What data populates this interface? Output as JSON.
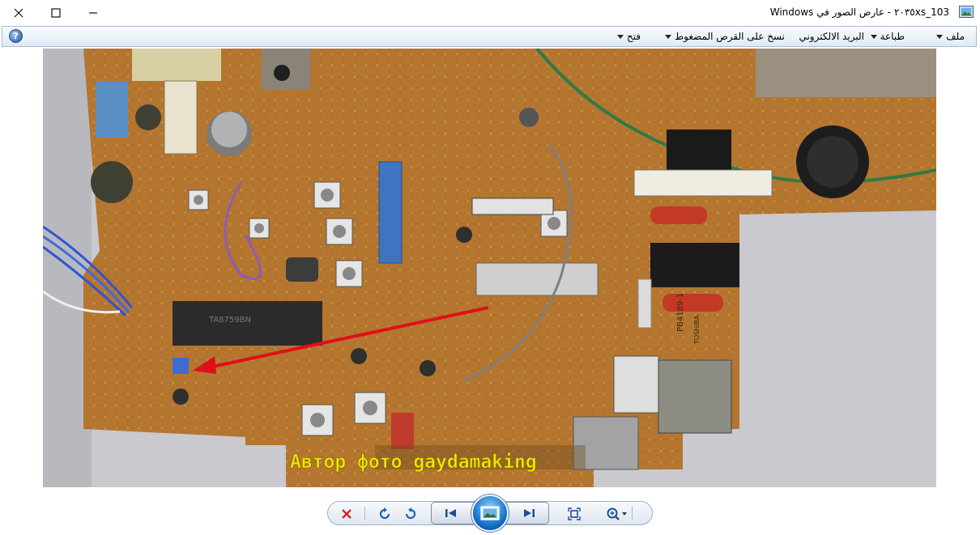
{
  "window": {
    "title": "٢٠٣٥xs_103 - عارض الصور في Windows"
  },
  "menu": {
    "file": "ملف",
    "print": "طباعة",
    "email": "البريد الالكتروني",
    "burn": "نسخ على القرص المضغوط",
    "open": "فتح"
  },
  "photo": {
    "watermark": "Автор фото gaydamaking",
    "chip_label": "TA8759BN",
    "board_label": "PB4189-1",
    "brand_label": "TOSHIBA",
    "colors": {
      "board": "#b5762f",
      "annotation_arrow": "#e0101a",
      "watermark": "#f2e600"
    }
  },
  "controls": {
    "icons": [
      "delete-icon",
      "rotate-clockwise-icon",
      "rotate-counterclockwise-icon",
      "previous-icon",
      "slideshow-icon",
      "next-icon",
      "actual-size-icon",
      "zoom-icon"
    ]
  }
}
